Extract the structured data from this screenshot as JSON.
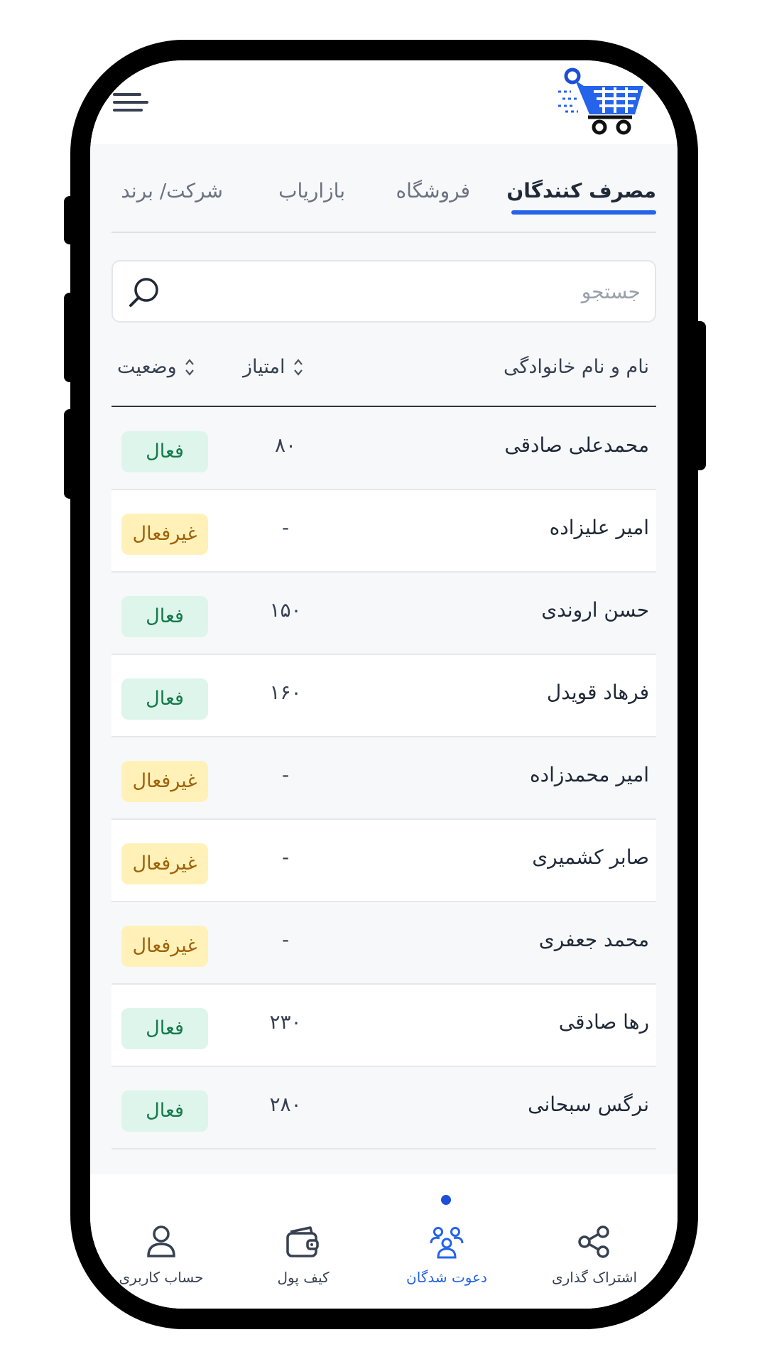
{
  "header": {
    "logo_icon": "shopping-cart-icon",
    "menu_icon": "menu-icon"
  },
  "tabs": [
    {
      "label": "مصرف کنندگان",
      "active": true
    },
    {
      "label": "فروشگاه",
      "active": false
    },
    {
      "label": "بازاریاب",
      "active": false
    },
    {
      "label": "شرکت/ برند",
      "active": false
    }
  ],
  "search": {
    "placeholder": "جستجو",
    "icon": "search-icon"
  },
  "table": {
    "columns": {
      "name": "نام و نام خانوادگی",
      "score": "امتیاز",
      "status": "وضعیت"
    },
    "rows": [
      {
        "name": "محمدعلی صادقی",
        "score": "۸۰",
        "status": "فعال",
        "active": true
      },
      {
        "name": "امیر علیزاده",
        "score": "-",
        "status": "غیرفعال",
        "active": false
      },
      {
        "name": "حسن اروندی",
        "score": "۱۵۰",
        "status": "فعال",
        "active": true
      },
      {
        "name": "فرهاد قویدل",
        "score": "۱۶۰",
        "status": "فعال",
        "active": true
      },
      {
        "name": "امیر محمدزاده",
        "score": "-",
        "status": "غیرفعال",
        "active": false
      },
      {
        "name": "صابر کشمیری",
        "score": "-",
        "status": "غیرفعال",
        "active": false
      },
      {
        "name": "محمد جعفری",
        "score": "-",
        "status": "غیرفعال",
        "active": false
      },
      {
        "name": "رها صادقی",
        "score": "۲۳۰",
        "status": "فعال",
        "active": true
      },
      {
        "name": "نرگس سبحانی",
        "score": "۲۸۰",
        "status": "فعال",
        "active": true
      }
    ]
  },
  "bottom_nav": [
    {
      "label": "اشتراک گذاری",
      "icon": "share-icon",
      "active": false
    },
    {
      "label": "دعوت شدگان",
      "icon": "invitees-icon",
      "active": true
    },
    {
      "label": "کیف پول",
      "icon": "wallet-icon",
      "active": false
    },
    {
      "label": "حساب کاربری",
      "icon": "user-icon",
      "active": false
    }
  ],
  "colors": {
    "accent": "#2563eb",
    "active_badge_bg": "#ddf5ea",
    "active_badge_text": "#16794c",
    "inactive_badge_bg": "#fff1b8",
    "inactive_badge_text": "#a0620b"
  }
}
